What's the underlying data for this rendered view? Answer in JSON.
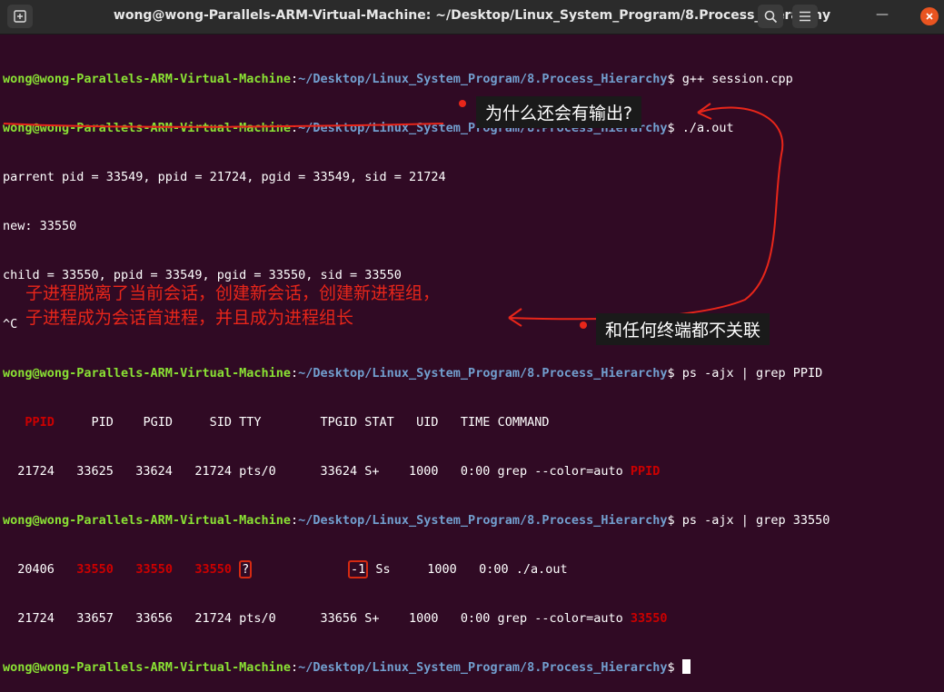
{
  "window": {
    "title": "wong@wong-Parallels-ARM-Virtual-Machine: ~/Desktop/Linux_System_Program/8.Process_Hierarchy",
    "new_tab_icon": "new-tab-icon",
    "search_icon": "search-icon",
    "menu_icon": "hamburger-menu-icon",
    "minimize_label": "—",
    "close_icon": "close-icon"
  },
  "prompt": {
    "user_host": "wong@wong-Parallels-ARM-Virtual-Machine",
    "path": "~/Desktop/Linux_System_Program/8.Process_Hierarchy"
  },
  "terminal": {
    "cmd1": "g++ session.cpp",
    "cmd2": "./a.out",
    "out_parent": "parrent pid = 33549, ppid = 21724, pgid = 33549, sid = 21724",
    "out_new": "new: 33550",
    "out_child": "child = 33550, ppid = 33549, pgid = 33550, sid = 33550",
    "out_ctrlc": "^C",
    "cmd3": "ps -ajx | grep PPID",
    "header_ppid": "PPID",
    "header_rest": "     PID    PGID     SID TTY        TPGID STAT   UID   TIME COMMAND",
    "row1_main": "  21724   33625   33624   21724 pts/0      33624 S+    1000   0:00 grep --color=auto ",
    "row1_match": "PPID",
    "cmd4": "ps -ajx | grep 33550",
    "row2_ppid": "  20406",
    "row2_pid": "33550",
    "row2_pgid": "33550",
    "row2_sid": "33550",
    "row2_tty": "?",
    "row2_tpgid": "-1",
    "row2_rest": " Ss     1000   0:00 ./a.out",
    "row3_main": "  21724   33657   33656   21724 pts/0      33656 S+    1000   0:00 grep --color=auto ",
    "row3_match": "33550"
  },
  "annotations": {
    "question": "为什么还会有输出?",
    "explain_line1": "子进程脱离了当前会话，创建新会话，创建新进程组，",
    "explain_line2": "子进程成为会话首进程，并且成为进程组长",
    "no_terminal": "和任何终端都不关联"
  },
  "colors": {
    "background": "#300a24",
    "prompt_green": "#8ae234",
    "path_blue": "#729fcf",
    "grep_match_red": "#cc0000",
    "annotation_red": "#e8261a"
  }
}
